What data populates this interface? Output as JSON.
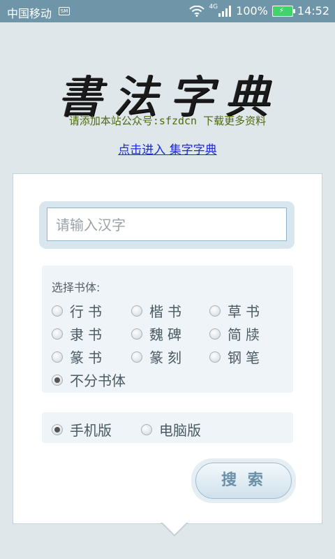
{
  "status_bar": {
    "carrier": "中国移动",
    "carrier_badge": "SM",
    "network": "4G",
    "battery": "100%",
    "time": "14:52"
  },
  "logo": {
    "chars": [
      "書",
      "法",
      "字",
      "典"
    ]
  },
  "subtitle": "请添加本站公众号:sfzdcn 下载更多资料",
  "enter_link": "点击进入 集字字典",
  "search": {
    "placeholder": "请输入汉字",
    "button_label": "搜 索"
  },
  "font_style": {
    "label": "选择书体:",
    "options": [
      "行书",
      "楷书",
      "草书",
      "隶书",
      "魏碑",
      "简牍",
      "篆书",
      "篆刻",
      "钢笔",
      "不分书体"
    ],
    "selected": "不分书体"
  },
  "version": {
    "options": [
      "手机版",
      "电脑版"
    ],
    "selected": "手机版"
  }
}
